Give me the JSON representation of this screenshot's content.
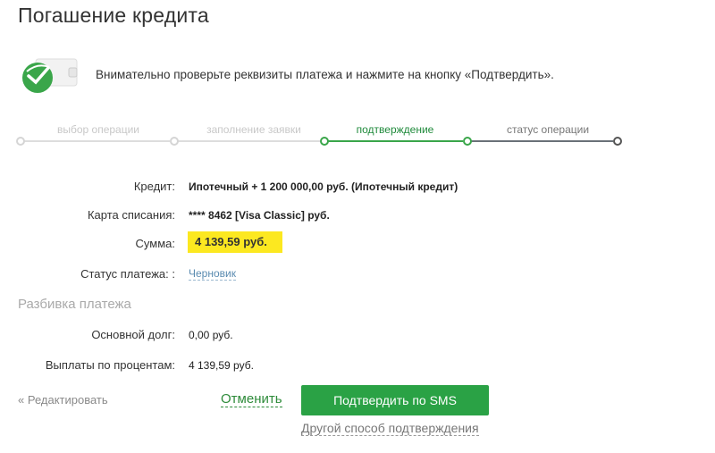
{
  "page": {
    "title": "Погашение кредита"
  },
  "notice": {
    "text": "Внимательно проверьте реквизиты платежа и нажмите на кнопку «Подтвердить»."
  },
  "steps": [
    {
      "label": "выбор операции",
      "state": "done"
    },
    {
      "label": "заполнение заявки",
      "state": "done"
    },
    {
      "label": "подтверждение",
      "state": "active"
    },
    {
      "label": "статус операции",
      "state": "next"
    }
  ],
  "details": {
    "credit": {
      "label": "Кредит:",
      "value": "Ипотечный + 1 200 000,00 руб. (Ипотечный кредит)"
    },
    "card": {
      "label": "Карта списания:",
      "value": "**** 8462 [Visa Classic] руб."
    },
    "amount": {
      "label": "Сумма:",
      "value": "4 139,59 руб."
    },
    "status": {
      "label": "Статус платежа: :",
      "value": "Черновик"
    }
  },
  "breakdown": {
    "title": "Разбивка платежа",
    "principal": {
      "label": "Основной долг:",
      "value": "0,00 руб."
    },
    "interest": {
      "label": "Выплаты по процентам:",
      "value": "4 139,59 руб."
    }
  },
  "actions": {
    "edit": "« Редактировать",
    "cancel": "Отменить",
    "confirm": "Подтвердить по SMS",
    "other": "Другой способ подтверждения"
  },
  "colors": {
    "accent": "#2aa245",
    "highlight": "#fce820",
    "link": "#5a8bb0"
  },
  "icons": {
    "logo": "sberbank-logo-wallet-icon"
  }
}
